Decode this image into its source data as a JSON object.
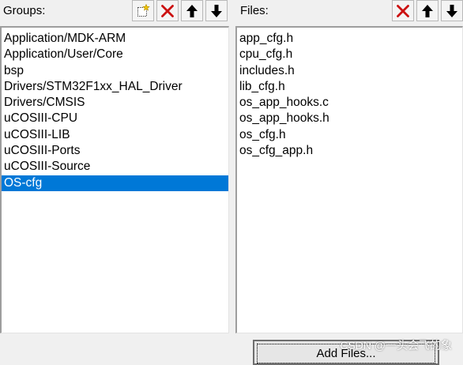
{
  "groups": {
    "label": "Groups:",
    "items": [
      "Application/MDK-ARM",
      "Application/User/Core",
      "bsp",
      "Drivers/STM32F1xx_HAL_Driver",
      "Drivers/CMSIS",
      "uCOSIII-CPU",
      "uCOSIII-LIB",
      "uCOSIII-Ports",
      "uCOSIII-Source",
      "OS-cfg"
    ],
    "selected_item": "OS-cfg",
    "toolbar_icons": [
      "new-group-icon",
      "delete-icon",
      "move-up-icon",
      "move-down-icon"
    ]
  },
  "files": {
    "label": "Files:",
    "items": [
      "app_cfg.h",
      "cpu_cfg.h",
      "includes.h",
      "lib_cfg.h",
      "os_app_hooks.c",
      "os_app_hooks.h",
      "os_cfg.h",
      "os_cfg_app.h"
    ],
    "toolbar_icons": [
      "delete-icon",
      "move-up-icon",
      "move-down-icon"
    ]
  },
  "add_files_label": "Add Files...",
  "watermark": "CSDN @一头会飞的象",
  "colors": {
    "selection": "#0078d7",
    "delete_icon": "#cc1111",
    "background": "#f0f0f0"
  }
}
